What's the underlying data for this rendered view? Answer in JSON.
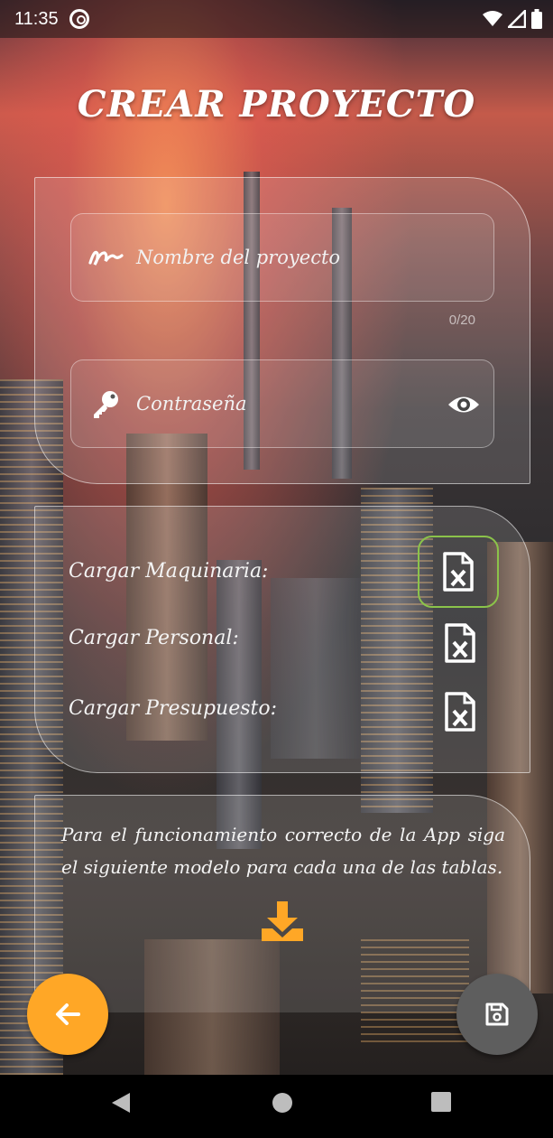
{
  "status_bar": {
    "time": "11:35",
    "icons": [
      "app-notification-icon",
      "wifi-icon",
      "signal-icon",
      "battery-icon"
    ]
  },
  "header": {
    "title": "CREAR PROYECTO"
  },
  "project_form": {
    "name_field": {
      "placeholder": "Nombre del proyecto",
      "icon": "signature-icon",
      "counter": "0/20"
    },
    "password_field": {
      "placeholder": "Contraseña",
      "icon": "key-icon",
      "toggle_icon": "eye-icon"
    }
  },
  "uploads": {
    "items": [
      {
        "label": "Cargar Maquinaria:",
        "icon": "excel-file-icon",
        "selected": true
      },
      {
        "label": "Cargar Personal:",
        "icon": "excel-file-icon",
        "selected": false
      },
      {
        "label": "Cargar Presupuesto:",
        "icon": "excel-file-icon",
        "selected": false
      }
    ],
    "selected_border_color": "#8bc34a"
  },
  "info": {
    "text": "Para el funcionamiento correcto de la App siga el siguiente modelo para cada una de las tablas.",
    "download_icon": "download-icon",
    "accent": "#ffa726"
  },
  "fabs": {
    "back": {
      "icon": "arrow-left-icon",
      "color": "#ffa726"
    },
    "save": {
      "icon": "save-icon",
      "color": "#5e5e5e"
    }
  },
  "nav_bar": {
    "icons": [
      "nav-back-icon",
      "nav-home-icon",
      "nav-recents-icon"
    ]
  }
}
